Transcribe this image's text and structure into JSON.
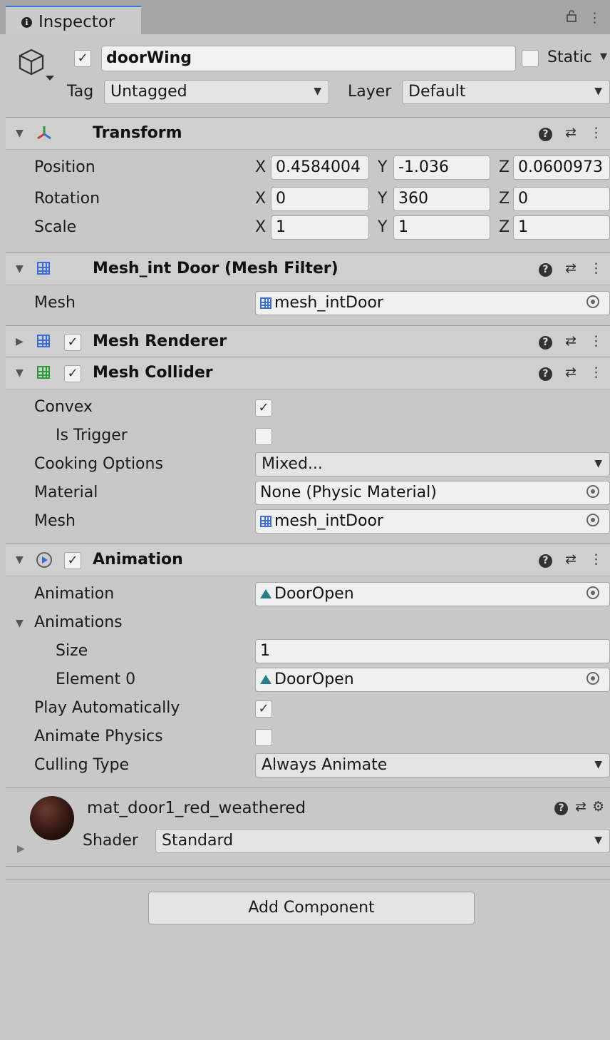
{
  "window": {
    "tab_title": "Inspector"
  },
  "gameobject": {
    "active_checked": true,
    "name": "doorWing",
    "static_label": "Static",
    "tag_label": "Tag",
    "tag_value": "Untagged",
    "layer_label": "Layer",
    "layer_value": "Default"
  },
  "transform": {
    "title": "Transform",
    "position": {
      "label": "Position",
      "x": "0.4584004",
      "y": "-1.036",
      "z": "0.0600973"
    },
    "rotation": {
      "label": "Rotation",
      "x": "0",
      "y": "360",
      "z": "0"
    },
    "scale": {
      "label": "Scale",
      "x": "1",
      "y": "1",
      "z": "1"
    },
    "axis_x": "X",
    "axis_y": "Y",
    "axis_z": "Z"
  },
  "mesh_filter": {
    "title": "Mesh_int Door (Mesh Filter)",
    "mesh_label": "Mesh",
    "mesh_value": "mesh_intDoor"
  },
  "mesh_renderer": {
    "title": "Mesh Renderer",
    "enabled": true
  },
  "mesh_collider": {
    "title": "Mesh Collider",
    "enabled": true,
    "convex_label": "Convex",
    "convex": true,
    "is_trigger_label": "Is Trigger",
    "is_trigger": false,
    "cooking_label": "Cooking Options",
    "cooking_value": "Mixed...",
    "material_label": "Material",
    "material_value": "None (Physic Material)",
    "mesh_label": "Mesh",
    "mesh_value": "mesh_intDoor"
  },
  "animation": {
    "title": "Animation",
    "enabled": true,
    "animation_label": "Animation",
    "animation_value": "DoorOpen",
    "animations_label": "Animations",
    "size_label": "Size",
    "size_value": "1",
    "element0_label": "Element 0",
    "element0_value": "DoorOpen",
    "play_auto_label": "Play Automatically",
    "play_auto": true,
    "animate_physics_label": "Animate Physics",
    "animate_physics": false,
    "culling_label": "Culling Type",
    "culling_value": "Always Animate"
  },
  "material": {
    "name": "mat_door1_red_weathered",
    "shader_label": "Shader",
    "shader_value": "Standard"
  },
  "add_component_label": "Add Component",
  "icons": {
    "check": "✓",
    "caret_down": "▼",
    "fold_open": "▼",
    "fold_closed": "▶",
    "lock": "lock-icon",
    "kebab": "⋮",
    "presets": "⇄",
    "help": "?",
    "gear": "⚙"
  },
  "colors": {
    "accent": "#3a79d8",
    "panel_bg": "#c8c8c8",
    "header_bg": "#cfcfcf",
    "field_bg": "#f0f0f0"
  }
}
